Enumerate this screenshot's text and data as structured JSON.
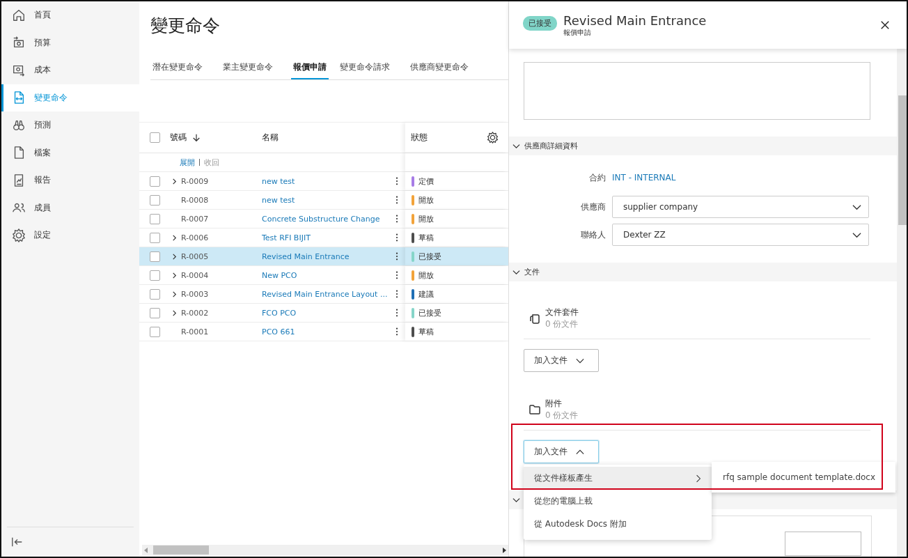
{
  "sidebar": {
    "items": [
      {
        "label": "首頁",
        "selected": false
      },
      {
        "label": "預算",
        "selected": false
      },
      {
        "label": "成本",
        "selected": false
      },
      {
        "label": "變更命令",
        "selected": true
      },
      {
        "label": "預測",
        "selected": false
      },
      {
        "label": "檔案",
        "selected": false
      },
      {
        "label": "報告",
        "selected": false
      },
      {
        "label": "成員",
        "selected": false
      },
      {
        "label": "設定",
        "selected": false
      }
    ]
  },
  "page": {
    "title": "變更命令"
  },
  "tabs": [
    {
      "label": "潛在變更命令",
      "selected": false
    },
    {
      "label": "業主變更命令",
      "selected": false
    },
    {
      "label": "報價申請",
      "selected": true
    },
    {
      "label": "變更命令請求",
      "selected": false
    },
    {
      "label": "供應商變更命令",
      "selected": false
    }
  ],
  "table": {
    "all_checked": false,
    "columns": [
      "號碼",
      "名稱",
      "狀態"
    ],
    "expand_all": "展開",
    "collapse_all": "收回",
    "rows": [
      {
        "checked": false,
        "expandable": true,
        "number": "R-0009",
        "name": "new test",
        "status": "定價",
        "color": "#a77ce6",
        "selected": false
      },
      {
        "checked": false,
        "expandable": false,
        "number": "R-0008",
        "name": "new test",
        "status": "開放",
        "color": "#f2a33a",
        "selected": false
      },
      {
        "checked": false,
        "expandable": false,
        "number": "R-0007",
        "name": "Concrete Substructure Change",
        "status": "開放",
        "color": "#f2a33a",
        "selected": false
      },
      {
        "checked": false,
        "expandable": true,
        "number": "R-0006",
        "name": "Test RFI BIJIT",
        "status": "草稿",
        "color": "#4d4d4d",
        "selected": false
      },
      {
        "checked": false,
        "expandable": true,
        "number": "R-0005",
        "name": "Revised Main Entrance",
        "status": "已接受",
        "color": "#86d5c9",
        "selected": true
      },
      {
        "checked": false,
        "expandable": true,
        "number": "R-0004",
        "name": "New PCO",
        "status": "開放",
        "color": "#f2a33a",
        "selected": false
      },
      {
        "checked": false,
        "expandable": true,
        "number": "R-0003",
        "name": "Revised Main Entrance Layout ...",
        "status": "建議",
        "color": "#1f6fb5",
        "selected": false
      },
      {
        "checked": false,
        "expandable": true,
        "number": "R-0002",
        "name": "FCO PCO",
        "status": "已接受",
        "color": "#86d5c9",
        "selected": false
      },
      {
        "checked": false,
        "expandable": false,
        "number": "R-0001",
        "name": "PCO 661",
        "status": "草稿",
        "color": "#4d4d4d",
        "selected": false
      }
    ]
  },
  "panel": {
    "status_badge": "已接受",
    "title": "Revised Main Entrance",
    "subtitle": "報價申請",
    "supplier_section": {
      "title": "供應商詳細資料",
      "expanded": true,
      "contract_label": "合約",
      "contract": "INT - INTERNAL",
      "supplier_label": "供應商",
      "supplier": "supplier company",
      "contact_label": "聯絡人",
      "contact": "Dexter ZZ"
    },
    "documents_section": {
      "title": "文件",
      "expanded": true,
      "groups": [
        {
          "kind": "docset",
          "title": "文件套件",
          "count": "0 份文件",
          "button": "加入文件",
          "open": false
        },
        {
          "kind": "folder",
          "title": "附件",
          "count": "0 份文件",
          "button": "加入文件",
          "open": true
        }
      ]
    },
    "menu": {
      "items": [
        {
          "label": "從文件樣板產生",
          "has_submenu": true,
          "selected": true
        },
        {
          "label": "從您的電腦上載",
          "has_submenu": false,
          "selected": false
        },
        {
          "label": "從 Autodesk Docs 附加",
          "has_submenu": false,
          "selected": false
        }
      ],
      "submenu": [
        "rfq sample document template.docx"
      ]
    }
  }
}
